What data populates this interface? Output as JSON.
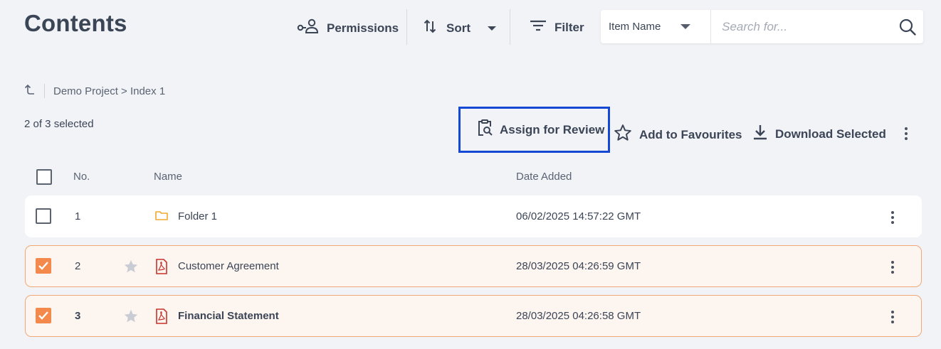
{
  "header": {
    "title": "Contents",
    "permissions_label": "Permissions",
    "sort_label": "Sort",
    "filter_label": "Filter",
    "field_select_value": "Item Name",
    "search_placeholder": "Search for..."
  },
  "breadcrumb": {
    "path": "Demo Project > Index 1"
  },
  "selection": {
    "count_text": "2 of 3 selected"
  },
  "actions": {
    "assign_label": "Assign for Review",
    "favourites_label": "Add to Favourites",
    "download_label": "Download Selected"
  },
  "table": {
    "columns": [
      "No.",
      "Name",
      "Date Added"
    ],
    "rows": [
      {
        "no": "1",
        "name": "Folder 1",
        "date": "06/02/2025 14:57:22 GMT",
        "type": "folder-icon",
        "checked": false,
        "starred": false
      },
      {
        "no": "2",
        "name": "Customer Agreement",
        "date": "28/03/2025 04:26:59 GMT",
        "type": "pdf-icon",
        "checked": true,
        "starred": false
      },
      {
        "no": "3",
        "name": "Financial Statement",
        "date": "28/03/2025 04:26:58 GMT",
        "type": "pdf-icon",
        "checked": true,
        "starred": false
      }
    ]
  },
  "colors": {
    "accent": "#f3894a",
    "highlight_border": "#1548d4",
    "background": "#f2f3f7",
    "folder": "#f0a830",
    "pdf": "#c8332b"
  }
}
